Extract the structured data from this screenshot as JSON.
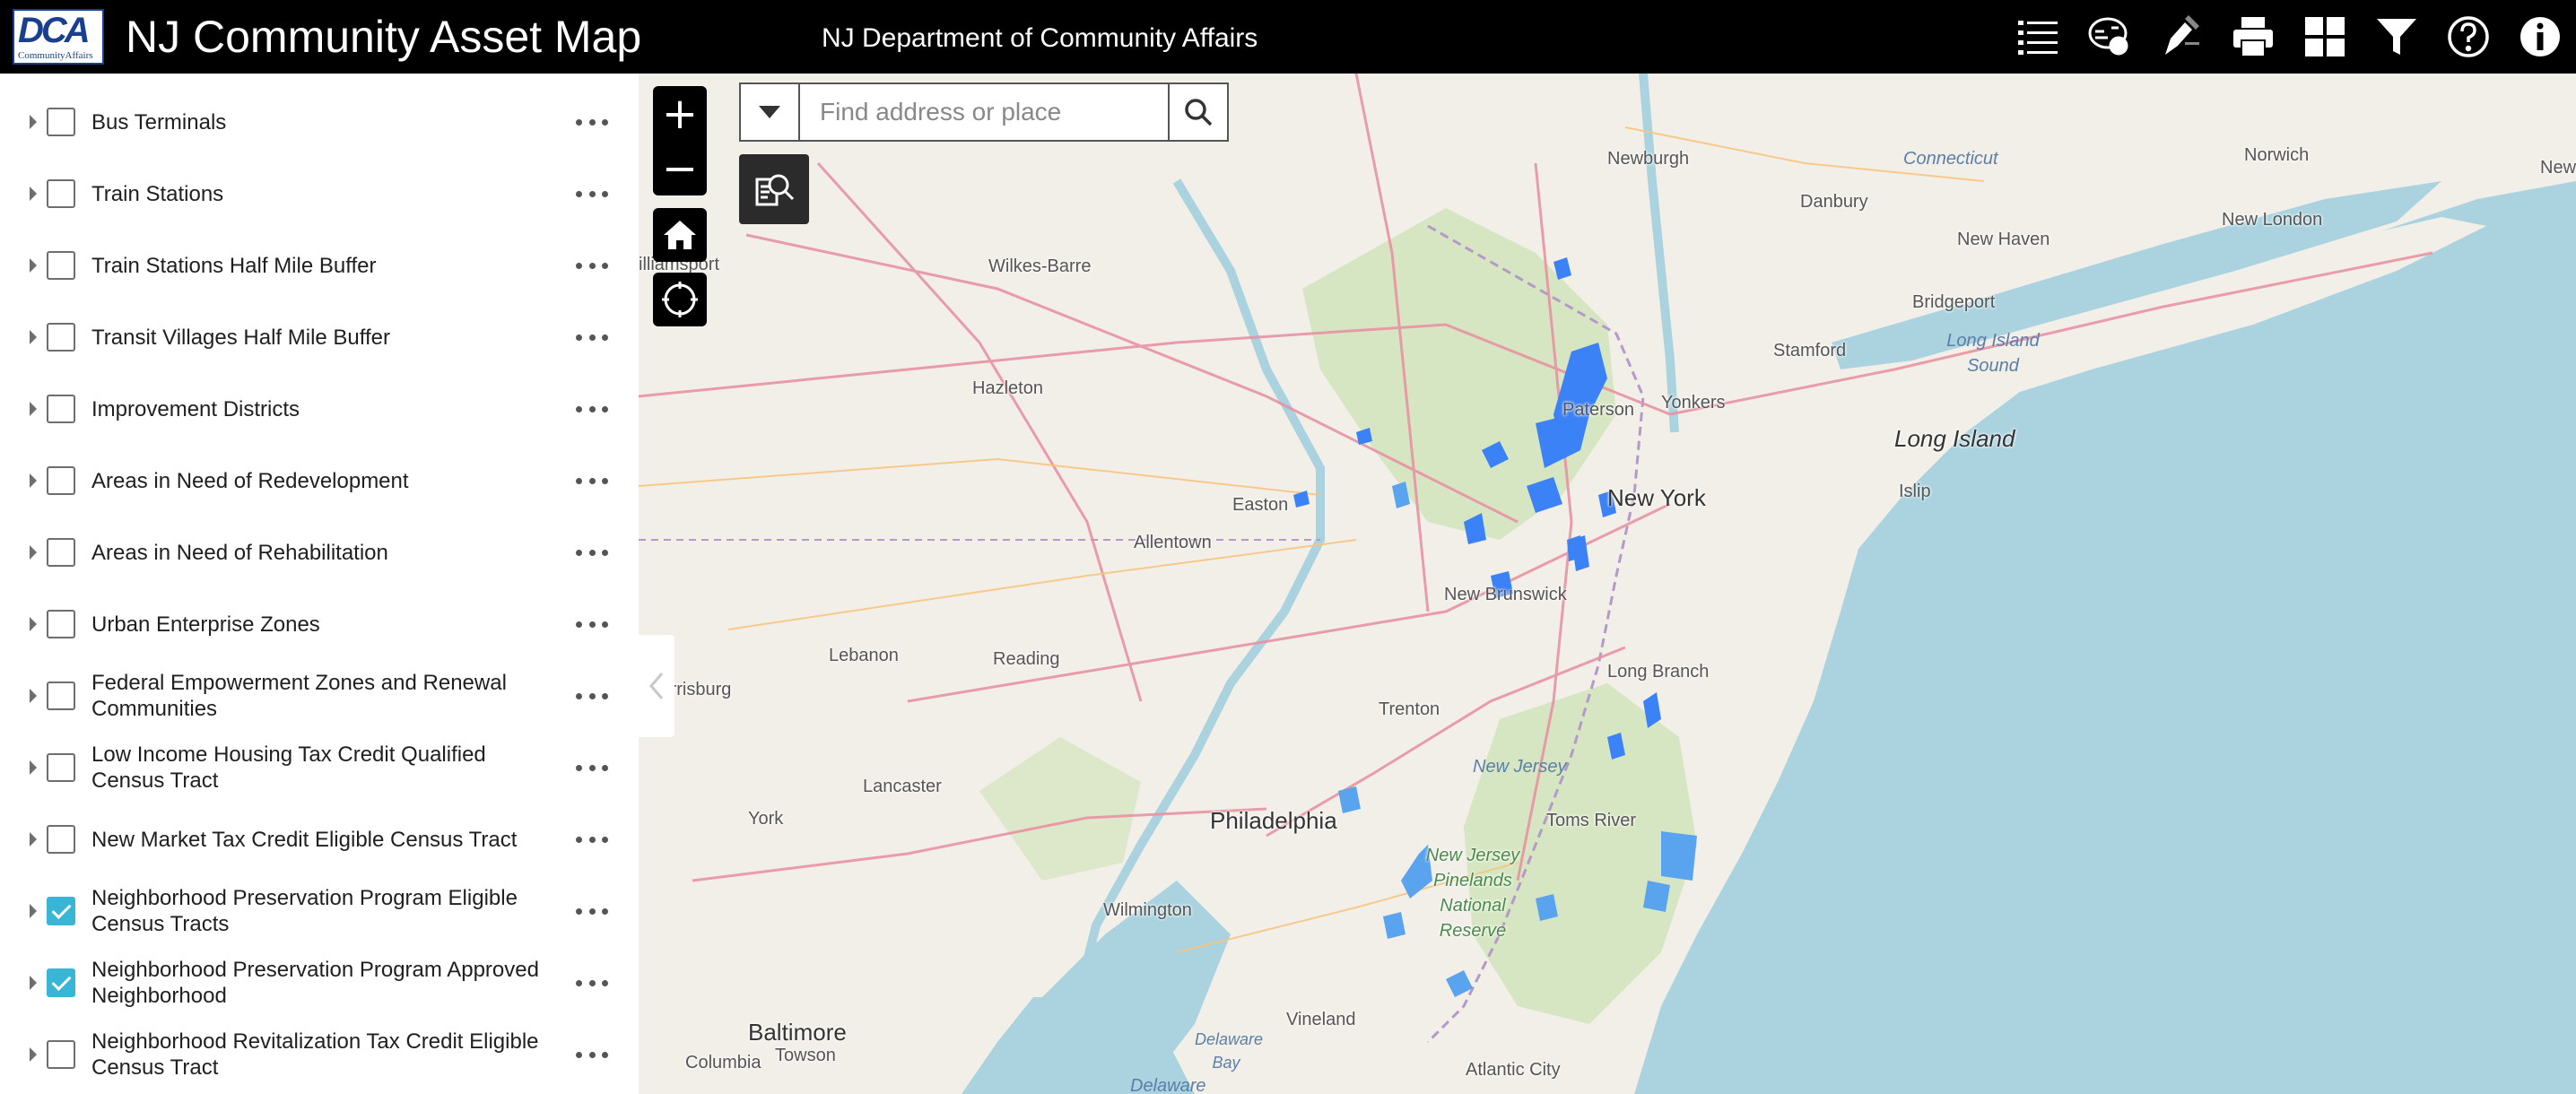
{
  "header": {
    "logo_text": "DCA",
    "logo_subtext": "CommunityAffairs",
    "title": "NJ Community Asset Map",
    "subtitle": "NJ Department of Community Affairs",
    "tools": [
      "layer-list-icon",
      "legend-icon",
      "draw-icon",
      "print-icon",
      "basemap-gallery-icon",
      "filter-icon",
      "help-icon",
      "about-icon"
    ]
  },
  "layers": [
    {
      "label": "Bus Terminals",
      "checked": false
    },
    {
      "label": "Train Stations",
      "checked": false
    },
    {
      "label": "Train Stations Half Mile Buffer",
      "checked": false
    },
    {
      "label": "Transit Villages Half Mile Buffer",
      "checked": false
    },
    {
      "label": "Improvement Districts",
      "checked": false
    },
    {
      "label": "Areas in Need of Redevelopment",
      "checked": false
    },
    {
      "label": "Areas in Need of Rehabilitation",
      "checked": false
    },
    {
      "label": "Urban Enterprise Zones",
      "checked": false
    },
    {
      "label": "Federal Empowerment Zones and Renewal Communities",
      "checked": false
    },
    {
      "label": "Low Income Housing Tax Credit Qualified Census Tract",
      "checked": false
    },
    {
      "label": "New Market Tax Credit Eligible Census Tract",
      "checked": false
    },
    {
      "label": "Neighborhood Preservation Program Eligible Census Tracts",
      "checked": true
    },
    {
      "label": "Neighborhood Preservation Program Approved Neighborhood",
      "checked": true
    },
    {
      "label": "Neighborhood Revitalization Tax Credit Eligible Census Tract",
      "checked": false
    }
  ],
  "map": {
    "zoom_in": "+",
    "zoom_out": "−",
    "search_placeholder": "Find address or place",
    "places": {
      "newburgh": "Newburgh",
      "connecticut": "Connecticut",
      "norwich": "Norwich",
      "newport": "Newport",
      "danbury": "Danbury",
      "new_london": "New London",
      "new_haven": "New Haven",
      "williamsport": "illiamsport",
      "wilkes_barre": "Wilkes-Barre",
      "bridgeport": "Bridgeport",
      "long_island_sound": "Long Island Sound",
      "stamford": "Stamford",
      "hazleton": "Hazleton",
      "paterson": "Paterson",
      "yonkers": "Yonkers",
      "long_island": "Long Island",
      "islip": "Islip",
      "easton": "Easton",
      "new_york": "New York",
      "allentown": "Allentown",
      "new_brunswick": "New Brunswick",
      "lebanon": "Lebanon",
      "reading": "Reading",
      "harrisburg": "Harrisburg",
      "long_branch": "Long Branch",
      "trenton": "Trenton",
      "new_jersey": "New Jersey",
      "lancaster": "Lancaster",
      "york": "York",
      "philadelphia": "Philadelphia",
      "toms_river": "Toms River",
      "wilmington": "Wilmington",
      "pinelands": "New Jersey Pinelands National Reserve",
      "vineland": "Vineland",
      "towson": "Towson",
      "atlantic_city": "Atlantic City",
      "baltimore": "Baltimore",
      "delaware_bay": "Delaware Bay",
      "columbia": "Columbia",
      "delaware": "Delaware"
    }
  }
}
